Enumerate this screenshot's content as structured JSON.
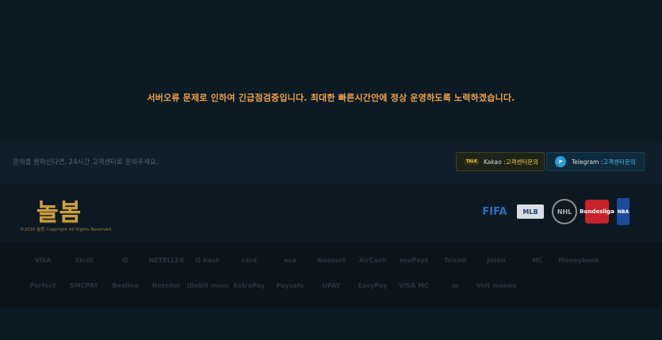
{
  "notice": {
    "message": "서버오류 문제로 인하여 긴급점검중입니다. 최대한 빠른시간안에 정상 운영하도록 노력하겠습니다."
  },
  "contact": {
    "text": "문의를 원하신다면, 24시간 고객센터로 문의주세요.",
    "kakao": {
      "badge": "TALK",
      "label": "Kakao : ",
      "link": "고객센터문의"
    },
    "telegram": {
      "label": "Telegram : ",
      "link": "고객센터문의"
    }
  },
  "brand": {
    "logo": "놀봄",
    "copyright": "©2016 눌봄 Copyright All Rights Reserved."
  },
  "leagues": [
    "FIFA",
    "MLB",
    "NHL",
    "Bundesliga",
    "NBA"
  ],
  "payments_row1": [
    "VISA",
    "Skrill",
    "Q",
    "NETELLER",
    "Q kash",
    "card",
    "eco",
    "Neosurf",
    "AirCash",
    "ecoPayz",
    "Telcell",
    "Jeton",
    "MC",
    "Moneybookers"
  ],
  "payments_row2": [
    "Perfect",
    "SMCPAY",
    "Beeline",
    "Neteller",
    "iDebit money",
    "AstroPay",
    "Paysafe",
    "UPAY",
    "EasyPay",
    "VISA MC",
    "m",
    "Volt money"
  ]
}
